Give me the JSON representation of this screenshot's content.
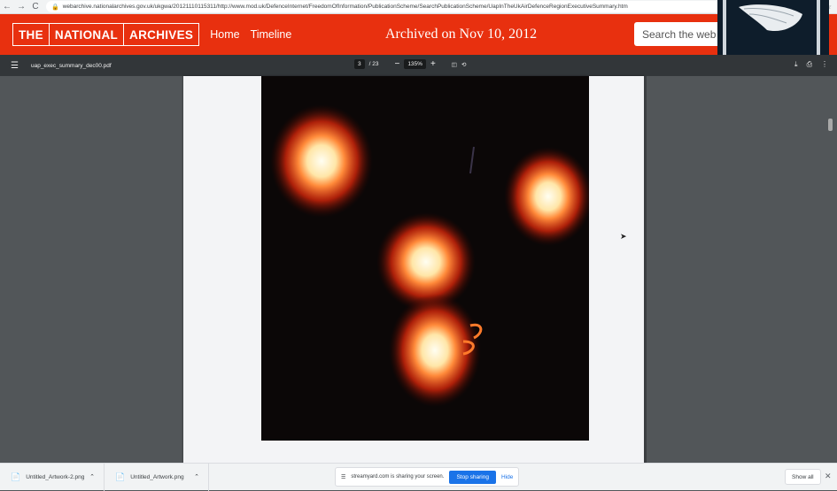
{
  "browser": {
    "back": "←",
    "forward": "→",
    "reload": "C",
    "url": "webarchive.nationalarchives.gov.uk/ukgwa/20121110115311/http://www.mod.uk/DefenceInternet/FreedomOfInformation/PublicationScheme/SearchPublicationScheme/UapInTheUkAirDefenceRegionExecutiveSummary.htm"
  },
  "archives": {
    "logo_words": [
      "THE",
      "NATIONAL",
      "ARCHIVES"
    ],
    "nav": [
      "Home",
      "Timeline"
    ],
    "archived_on": "Archived on Nov 10, 2012",
    "search_placeholder": "Search the web"
  },
  "pdf": {
    "filename": "uap_exec_summary_dec00.pdf",
    "current_page": "3",
    "page_total": "/ 23",
    "zoom": "135%"
  },
  "downloads": {
    "items": [
      {
        "name": "Untitled_Artwork-2.png"
      },
      {
        "name": "Untitled_Artwork.png"
      }
    ],
    "share_text": "streamyard.com is sharing your screen.",
    "stop_label": "Stop sharing",
    "hide_label": "Hide",
    "show_all_label": "Show all"
  },
  "icons": {
    "menu": "hamburger-icon",
    "download": "download-icon",
    "print": "print-icon",
    "more": "more-vert-icon"
  }
}
